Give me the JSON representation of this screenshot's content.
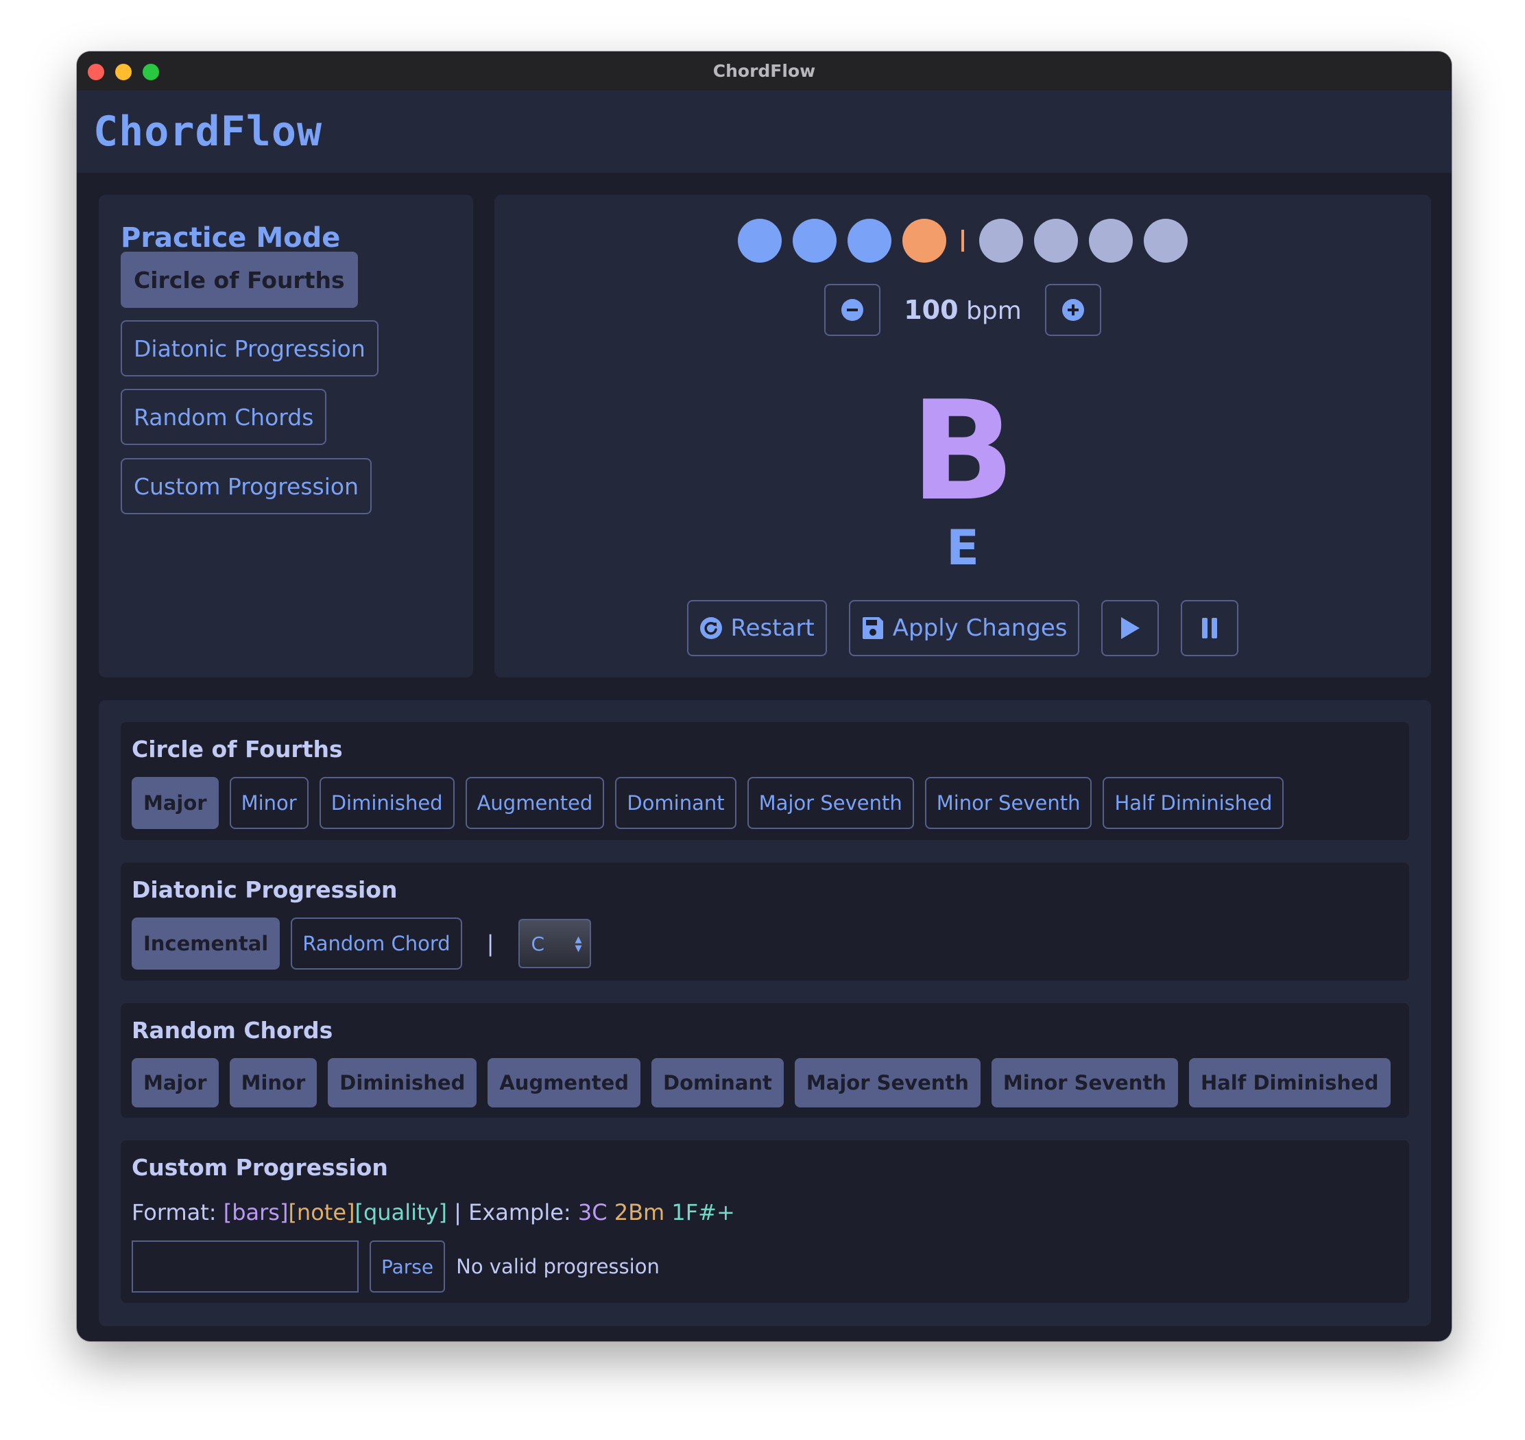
{
  "window": {
    "title": "ChordFlow"
  },
  "app": {
    "title": "ChordFlow"
  },
  "practice_mode": {
    "title": "Practice Mode",
    "modes": [
      {
        "label": "Circle of Fourths",
        "active": true
      },
      {
        "label": "Diatonic Progression",
        "active": false
      },
      {
        "label": "Random Chords",
        "active": false
      },
      {
        "label": "Custom Progression",
        "active": false
      }
    ]
  },
  "player": {
    "beats_bar1": [
      "played",
      "played",
      "played",
      "current"
    ],
    "beats_bar2": [
      "upcoming",
      "upcoming",
      "upcoming",
      "upcoming"
    ],
    "tempo": {
      "value": "100",
      "unit": "bpm"
    },
    "current_chord": "B",
    "next_chord": "E",
    "restart_label": "Restart",
    "apply_label": "Apply Changes"
  },
  "settings": {
    "circle": {
      "title": "Circle of Fourths",
      "qualities": [
        {
          "label": "Major",
          "active": true
        },
        {
          "label": "Minor",
          "active": false
        },
        {
          "label": "Diminished",
          "active": false
        },
        {
          "label": "Augmented",
          "active": false
        },
        {
          "label": "Dominant",
          "active": false
        },
        {
          "label": "Major Seventh",
          "active": false
        },
        {
          "label": "Minor Seventh",
          "active": false
        },
        {
          "label": "Half Diminished",
          "active": false
        }
      ]
    },
    "diatonic": {
      "title": "Diatonic Progression",
      "incremental_label": "Incemental",
      "random_label": "Random Chord",
      "separator": "|",
      "key_value": "C"
    },
    "random": {
      "title": "Random Chords",
      "qualities": [
        {
          "label": "Major"
        },
        {
          "label": "Minor"
        },
        {
          "label": "Diminished"
        },
        {
          "label": "Augmented"
        },
        {
          "label": "Dominant"
        },
        {
          "label": "Major Seventh"
        },
        {
          "label": "Minor Seventh"
        },
        {
          "label": "Half Diminished"
        }
      ]
    },
    "custom": {
      "title": "Custom Progression",
      "format_prefix": "Format: ",
      "fmt_bars": "[bars]",
      "fmt_note": "[note]",
      "fmt_quality": "[quality]",
      "example_prefix": " | Example: ",
      "ex_1": "3C",
      "ex_2": "2Bm",
      "ex_3": "1F#+",
      "input_value": "",
      "parse_label": "Parse",
      "status": "No valid progression"
    }
  },
  "colors": {
    "accent_blue": "#7aa2f7",
    "accent_purple": "#bb9af7",
    "accent_orange": "#f29d6a",
    "muted": "#565f89",
    "panel_bg": "#24283b",
    "window_bg": "#1d1e2c"
  }
}
